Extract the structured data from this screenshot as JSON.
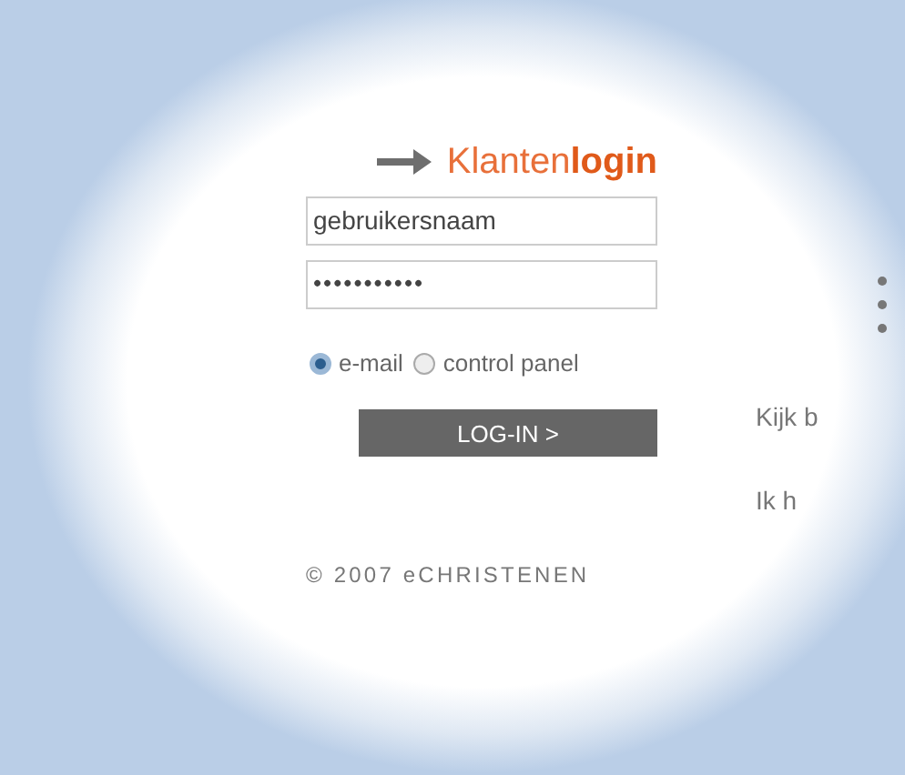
{
  "login": {
    "title_light": "Klanten",
    "title_bold": "login",
    "username": {
      "value": "gebruikersnaam"
    },
    "password": {
      "value": "•••••••••••"
    },
    "login_type": [
      {
        "label": "e-mail",
        "selected": true
      },
      {
        "label": "control panel",
        "selected": false
      }
    ],
    "button": "LOG-IN >",
    "copyright": "© 2007 eCHRISTENEN"
  },
  "side": {
    "lines": [
      "Kijk b",
      "Ik h"
    ]
  }
}
